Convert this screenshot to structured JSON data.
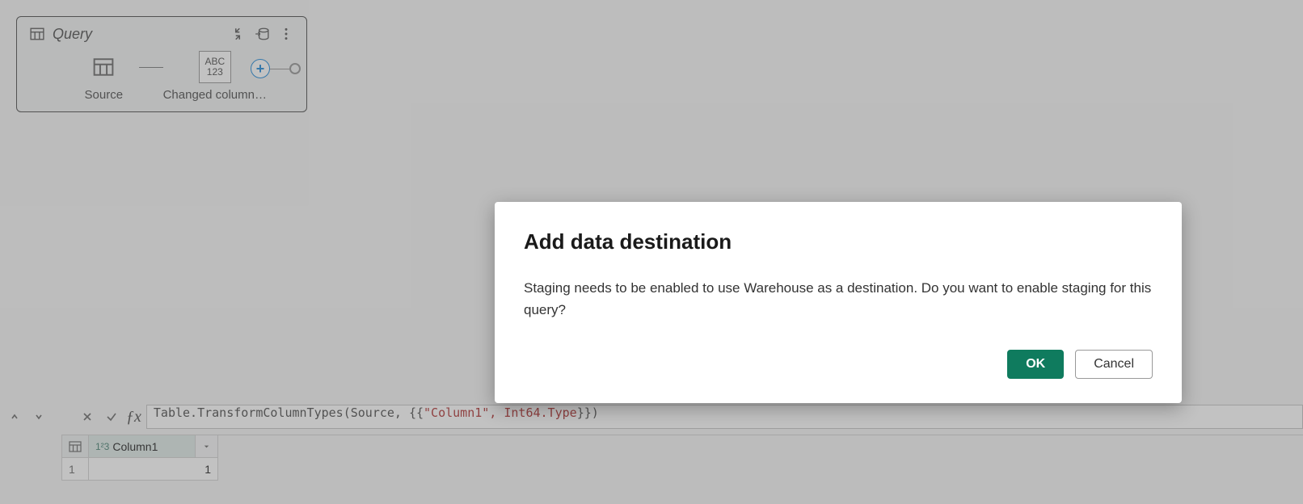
{
  "diagram": {
    "title": "Query",
    "steps": [
      {
        "label": "Source",
        "icon": "table"
      },
      {
        "label": "Changed column…",
        "icon": "abc123"
      }
    ]
  },
  "formulaBar": {
    "formula_prefix": "Table.TransformColumnTypes(Source, {{",
    "formula_string": "\"Column1\", Int64.Type",
    "formula_suffix": "}})"
  },
  "grid": {
    "column_type_label": "1²3",
    "column_name": "Column1",
    "rows": [
      {
        "n": "1",
        "v": "1"
      }
    ]
  },
  "dialog": {
    "title": "Add data destination",
    "body": "Staging needs to be enabled to use Warehouse as a destination. Do you want to enable staging for this query?",
    "ok": "OK",
    "cancel": "Cancel"
  }
}
